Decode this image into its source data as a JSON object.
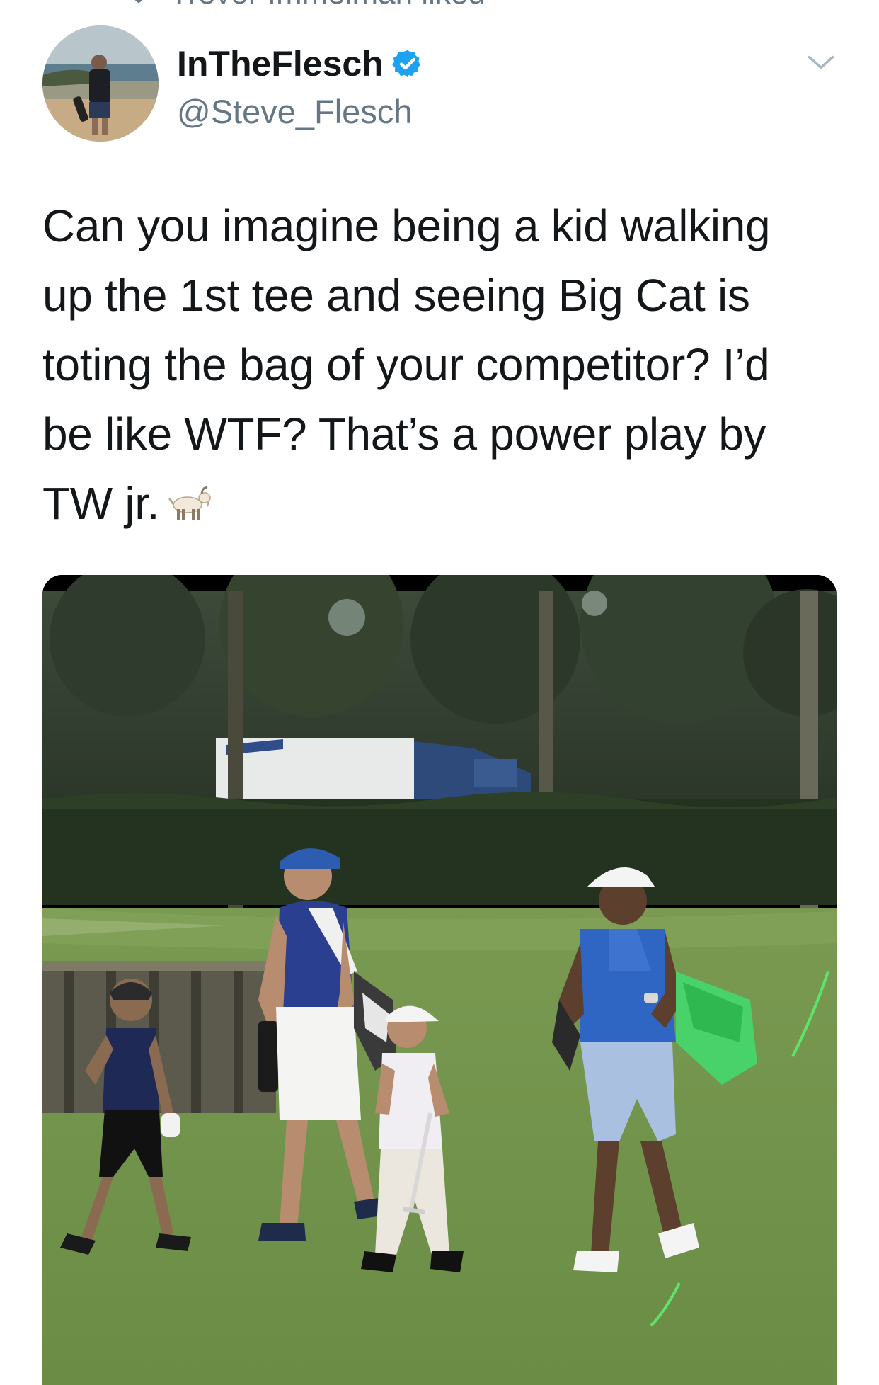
{
  "social_context": {
    "text": "Trevor Immelman liked"
  },
  "tweet": {
    "display_name": "InTheFlesch",
    "handle": "@Steve_Flesch",
    "verified": true,
    "text_lines": [
      "Can you imagine being a kid walking",
      "up the 1st tee and seeing Big Cat is",
      "toting the bag of your competitor? I’d",
      "be like WTF? That’s a power play by",
      "TW jr."
    ],
    "emoji": "goat"
  },
  "icons": {
    "heart": "heart-icon",
    "verified": "verified-badge-icon",
    "caret": "chevron-down-icon",
    "emoji": "goat-emoji-icon"
  },
  "colors": {
    "text_primary": "#14171a",
    "text_secondary": "#657786",
    "verified_blue": "#1da1f2",
    "caret_gray": "#aab8c2"
  }
}
